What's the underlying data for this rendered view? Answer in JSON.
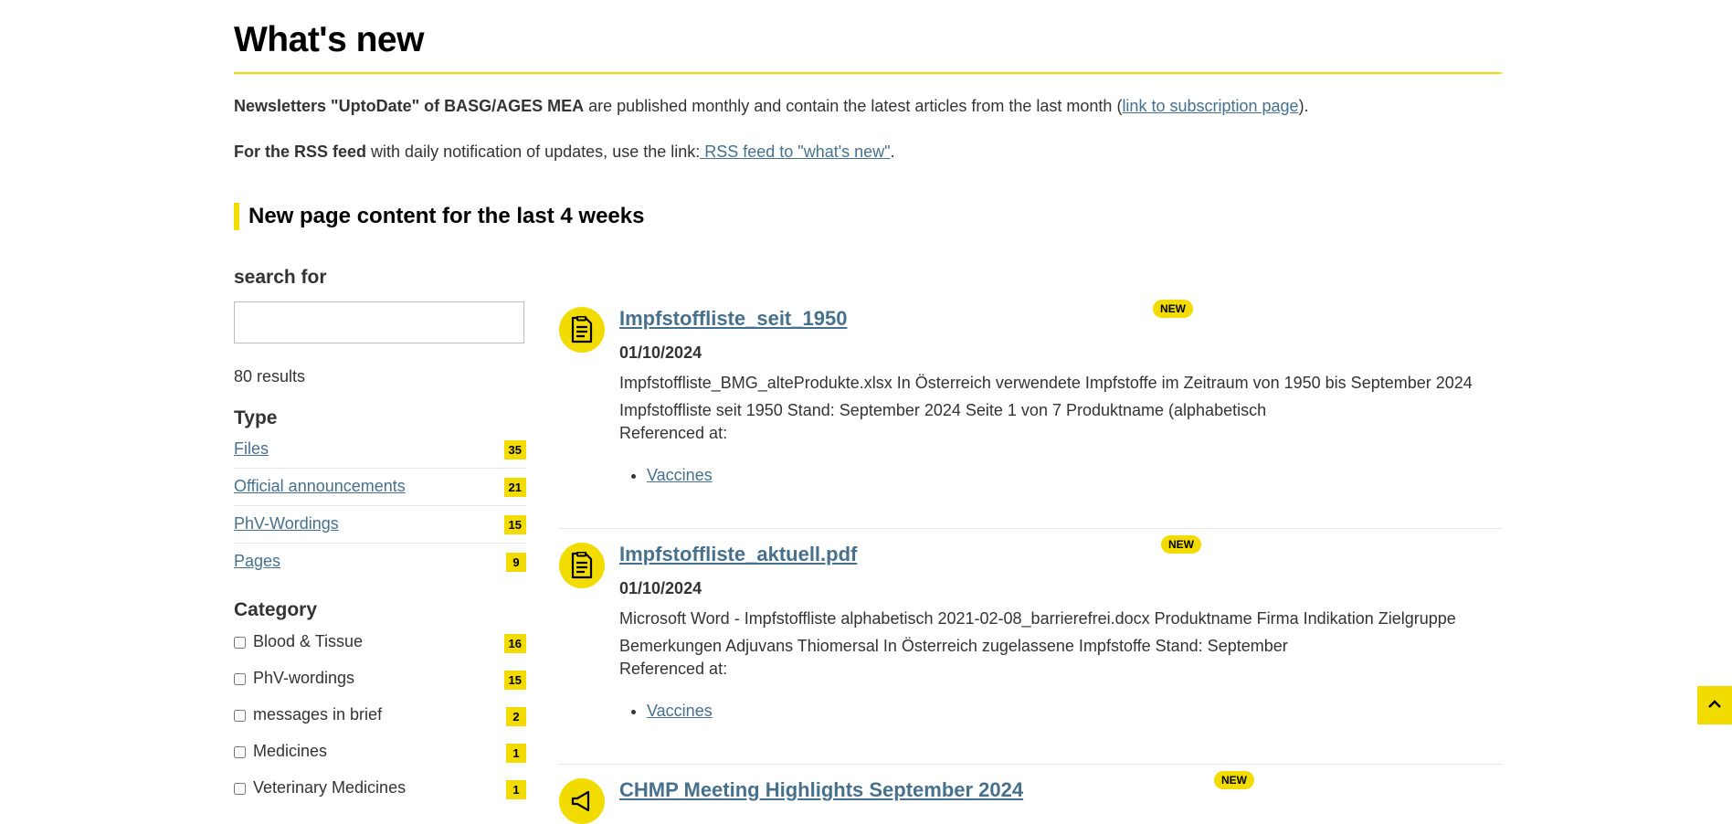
{
  "page": {
    "title": "What's new"
  },
  "intro": {
    "newsletter_bold": "Newsletters \"UptoDate\" of BASG/AGES MEA",
    "newsletter_text": " are published monthly and contain the latest articles from the last month (",
    "newsletter_link": "link to subscription page",
    "newsletter_end": ").",
    "rss_bold": "For the RSS feed",
    "rss_text": " with daily notification of updates, use the link:",
    "rss_link": " RSS feed to \"what's new\"",
    "rss_end": "."
  },
  "section": {
    "heading": "New page content for the last 4 weeks"
  },
  "sidebar": {
    "search_label": "search for",
    "search_value": "",
    "results_count": "80 results",
    "type_heading": "Type",
    "types": [
      {
        "label": "Files",
        "count": "35"
      },
      {
        "label": "Official announcements",
        "count": "21"
      },
      {
        "label": "PhV-Wordings",
        "count": "15"
      },
      {
        "label": "Pages",
        "count": "9"
      }
    ],
    "category_heading": "Category",
    "categories": [
      {
        "label": "Blood & Tissue",
        "count": "16"
      },
      {
        "label": "PhV-wordings",
        "count": "15"
      },
      {
        "label": "messages in brief",
        "count": "2"
      },
      {
        "label": "Medicines",
        "count": "1"
      },
      {
        "label": "Veterinary Medicines",
        "count": "1"
      }
    ]
  },
  "results": [
    {
      "icon": "document-icon",
      "title": "Impfstoffliste_seit_1950 ",
      "badge": "NEW",
      "date": "01/10/2024",
      "text_line1": "Impfstoffliste_BMG_alteProdukte.xlsx In Österreich verwendete Impfstoffe im Zeitraum von 1950 bis September 2024",
      "text_line2": "Impfstoffliste seit 1950 Stand: September 2024 Seite 1 von 7 Produktname (alphabetisch",
      "referenced_label": "Referenced at:",
      "references": [
        "Vaccines"
      ]
    },
    {
      "icon": "document-icon",
      "title": "Impfstoffliste_aktuell.pdf ",
      "badge": "NEW",
      "date": "01/10/2024",
      "text_line1": "Microsoft Word - Impfstoffliste alphabetisch 2021-02-08_barrierefrei.docx Produktname Firma Indikation Zielgruppe",
      "text_line2": "Bemerkungen Adjuvans Thiomersal In Österreich zugelassene Impfstoffe Stand: September",
      "referenced_label": "Referenced at:",
      "references": [
        "Vaccines"
      ]
    },
    {
      "icon": "megaphone-icon",
      "title": "CHMP Meeting Highlights September 2024 ",
      "badge": "NEW"
    }
  ],
  "colors": {
    "accent": "#f2dc00",
    "link": "#47708c",
    "text": "#333333"
  },
  "back_to_top": {
    "icon": "chevron-up-icon"
  }
}
